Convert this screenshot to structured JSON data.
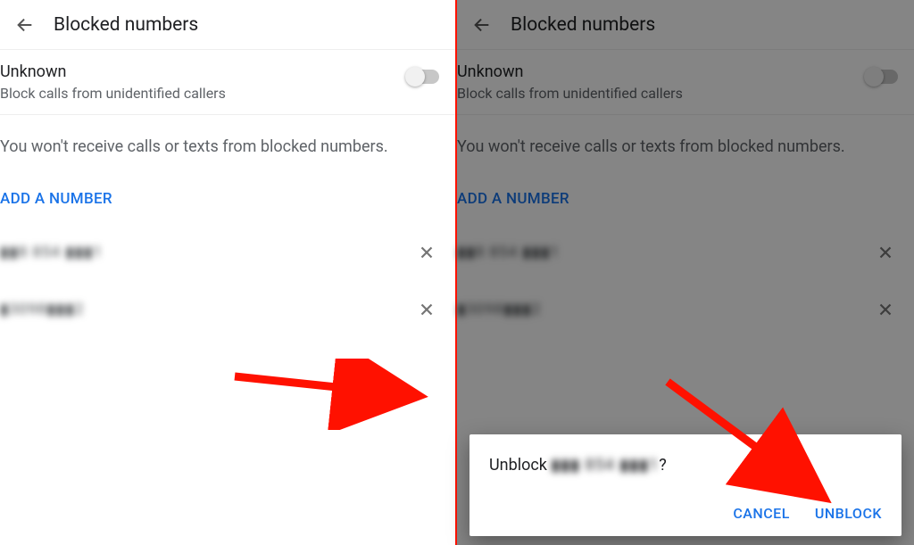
{
  "header": {
    "title": "Blocked numbers"
  },
  "unknown": {
    "title": "Unknown",
    "subtitle": "Block calls from unidentified callers",
    "enabled": false
  },
  "info_text": "You won't receive calls or texts from blocked numbers.",
  "add_label": "ADD A NUMBER",
  "numbers": [
    {
      "masked": "▮▮8 854 ▮▮▮1"
    },
    {
      "masked": "▮3098▮▮▮2"
    }
  ],
  "dialog": {
    "prefix": "Unblock ",
    "masked_number": "▮▮▮ 854 ▮▮▮1",
    "suffix": "?",
    "cancel": "CANCEL",
    "confirm": "UNBLOCK"
  }
}
